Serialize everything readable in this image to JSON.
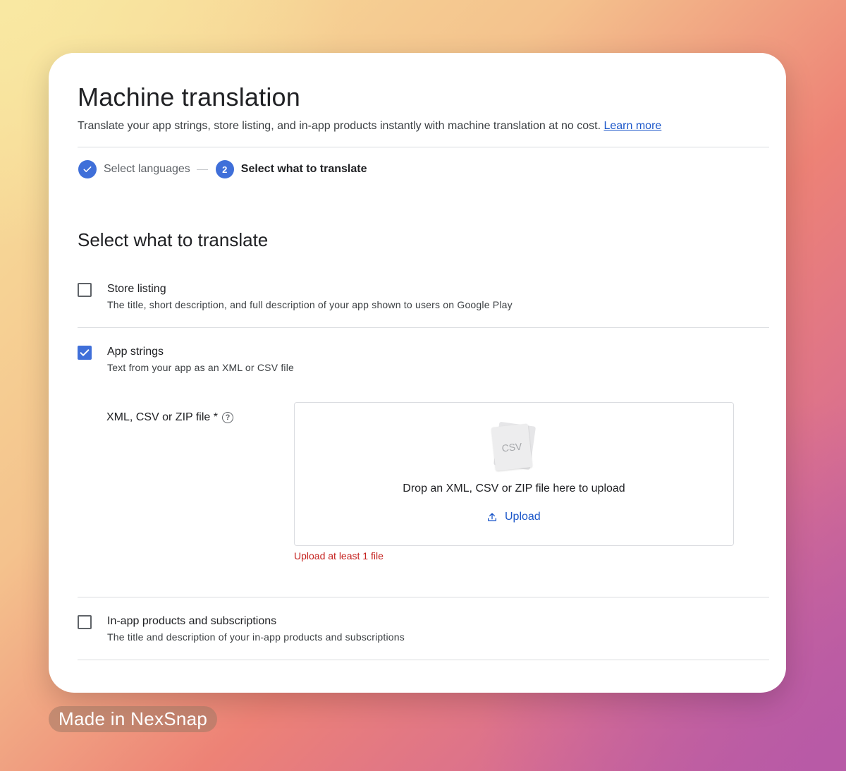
{
  "header": {
    "title": "Machine translation",
    "subtitle": "Translate your app strings, store listing, and in-app products instantly with machine translation at no cost.",
    "learn_more": "Learn more"
  },
  "stepper": {
    "steps": [
      {
        "label": "Select languages",
        "status": "completed"
      },
      {
        "number": "2",
        "label": "Select what to translate",
        "status": "active"
      }
    ]
  },
  "section": {
    "title": "Select what to translate",
    "options": [
      {
        "label": "Store listing",
        "description": "The title, short description, and full description of your app shown to users on Google Play",
        "checked": false
      },
      {
        "label": "App strings",
        "description": "Text from your app as an XML or CSV file",
        "checked": true
      },
      {
        "label": "In-app products and subscriptions",
        "description": "The title and description of your in-app products and subscriptions",
        "checked": false
      }
    ]
  },
  "upload": {
    "field_label": "XML, CSV or ZIP file *",
    "file_type": "CSV",
    "drop_text": "Drop an XML, CSV or ZIP file here to upload",
    "button_label": "Upload",
    "error": "Upload at least 1 file"
  },
  "watermark": "Made in NexSnap",
  "colors": {
    "accent": "#3f6fd9",
    "link": "#1a56c9",
    "error": "#c5221f"
  }
}
